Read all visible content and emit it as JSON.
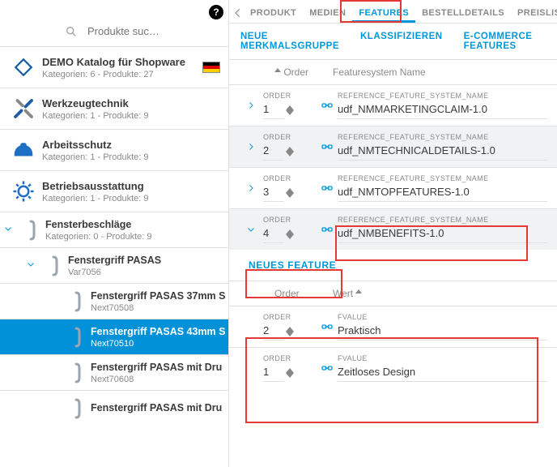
{
  "sidebar": {
    "search_placeholder": "Produkte suc…",
    "catalog": {
      "title": "DEMO Katalog für Shopware",
      "subtitle": "Kategorien: 6 - Produkte: 27"
    },
    "top_categories": [
      {
        "title": "Werkzeugtechnik",
        "subtitle": "Kategorien: 1 - Produkte: 9",
        "icon": "tools"
      },
      {
        "title": "Arbeitsschutz",
        "subtitle": "Kategorien: 1 - Produkte: 9",
        "icon": "helmet"
      },
      {
        "title": "Betriebsausstattung",
        "subtitle": "Kategorien: 1 - Produkte: 9",
        "icon": "gear"
      }
    ],
    "tree": [
      {
        "level": 1,
        "expand": "down",
        "title": "Fensterbeschläge",
        "subtitle": "Kategorien: 0 - Produkte: 9"
      },
      {
        "level": 2,
        "expand": "down",
        "title": "Fenstergriff PASAS",
        "subtitle": "Var7056"
      },
      {
        "level": 3,
        "expand": "",
        "title": "Fenstergriff PASAS 37mm S",
        "subtitle": "Next70508"
      },
      {
        "level": 3,
        "expand": "",
        "title": "Fenstergriff PASAS 43mm S",
        "subtitle": "Next70510",
        "selected": true
      },
      {
        "level": 3,
        "expand": "",
        "title": "Fenstergriff PASAS mit Dru",
        "subtitle": "Next70608"
      },
      {
        "level": 3,
        "expand": "",
        "title": "Fenstergriff PASAS mit Dru",
        "subtitle": ""
      }
    ]
  },
  "tabs": {
    "items": [
      "PRODUKT",
      "MEDIEN",
      "FEATURES",
      "BESTELLDETAILS",
      "PREISLISTEN"
    ],
    "active_index": 2
  },
  "subnav": [
    "NEUE MERKMALSGRUPPE",
    "KLASSIFIZIEREN",
    "E-COMMERCE FEATURES"
  ],
  "columns": {
    "order": "Order",
    "name": "Featuresystem Name"
  },
  "field_labels": {
    "order": "ORDER",
    "ref": "REFERENCE_FEATURE_SYSTEM_NAME",
    "fvalue": "FVALUE"
  },
  "feature_groups": [
    {
      "order": "1",
      "name": "udf_NMMARKETINGCLAIM-1.0",
      "expanded": false
    },
    {
      "order": "2",
      "name": "udf_NMTECHNICALDETAILS-1.0",
      "expanded": false
    },
    {
      "order": "3",
      "name": "udf_NMTOPFEATURES-1.0",
      "expanded": false
    },
    {
      "order": "4",
      "name": "udf_NMBENEFITS-1.0",
      "expanded": true
    }
  ],
  "new_feature_label": "NEUES FEATURE",
  "value_columns": {
    "order": "Order",
    "wert": "Wert"
  },
  "feature_values": [
    {
      "order": "2",
      "value": "Praktisch"
    },
    {
      "order": "1",
      "value": "Zeitloses Design"
    }
  ]
}
